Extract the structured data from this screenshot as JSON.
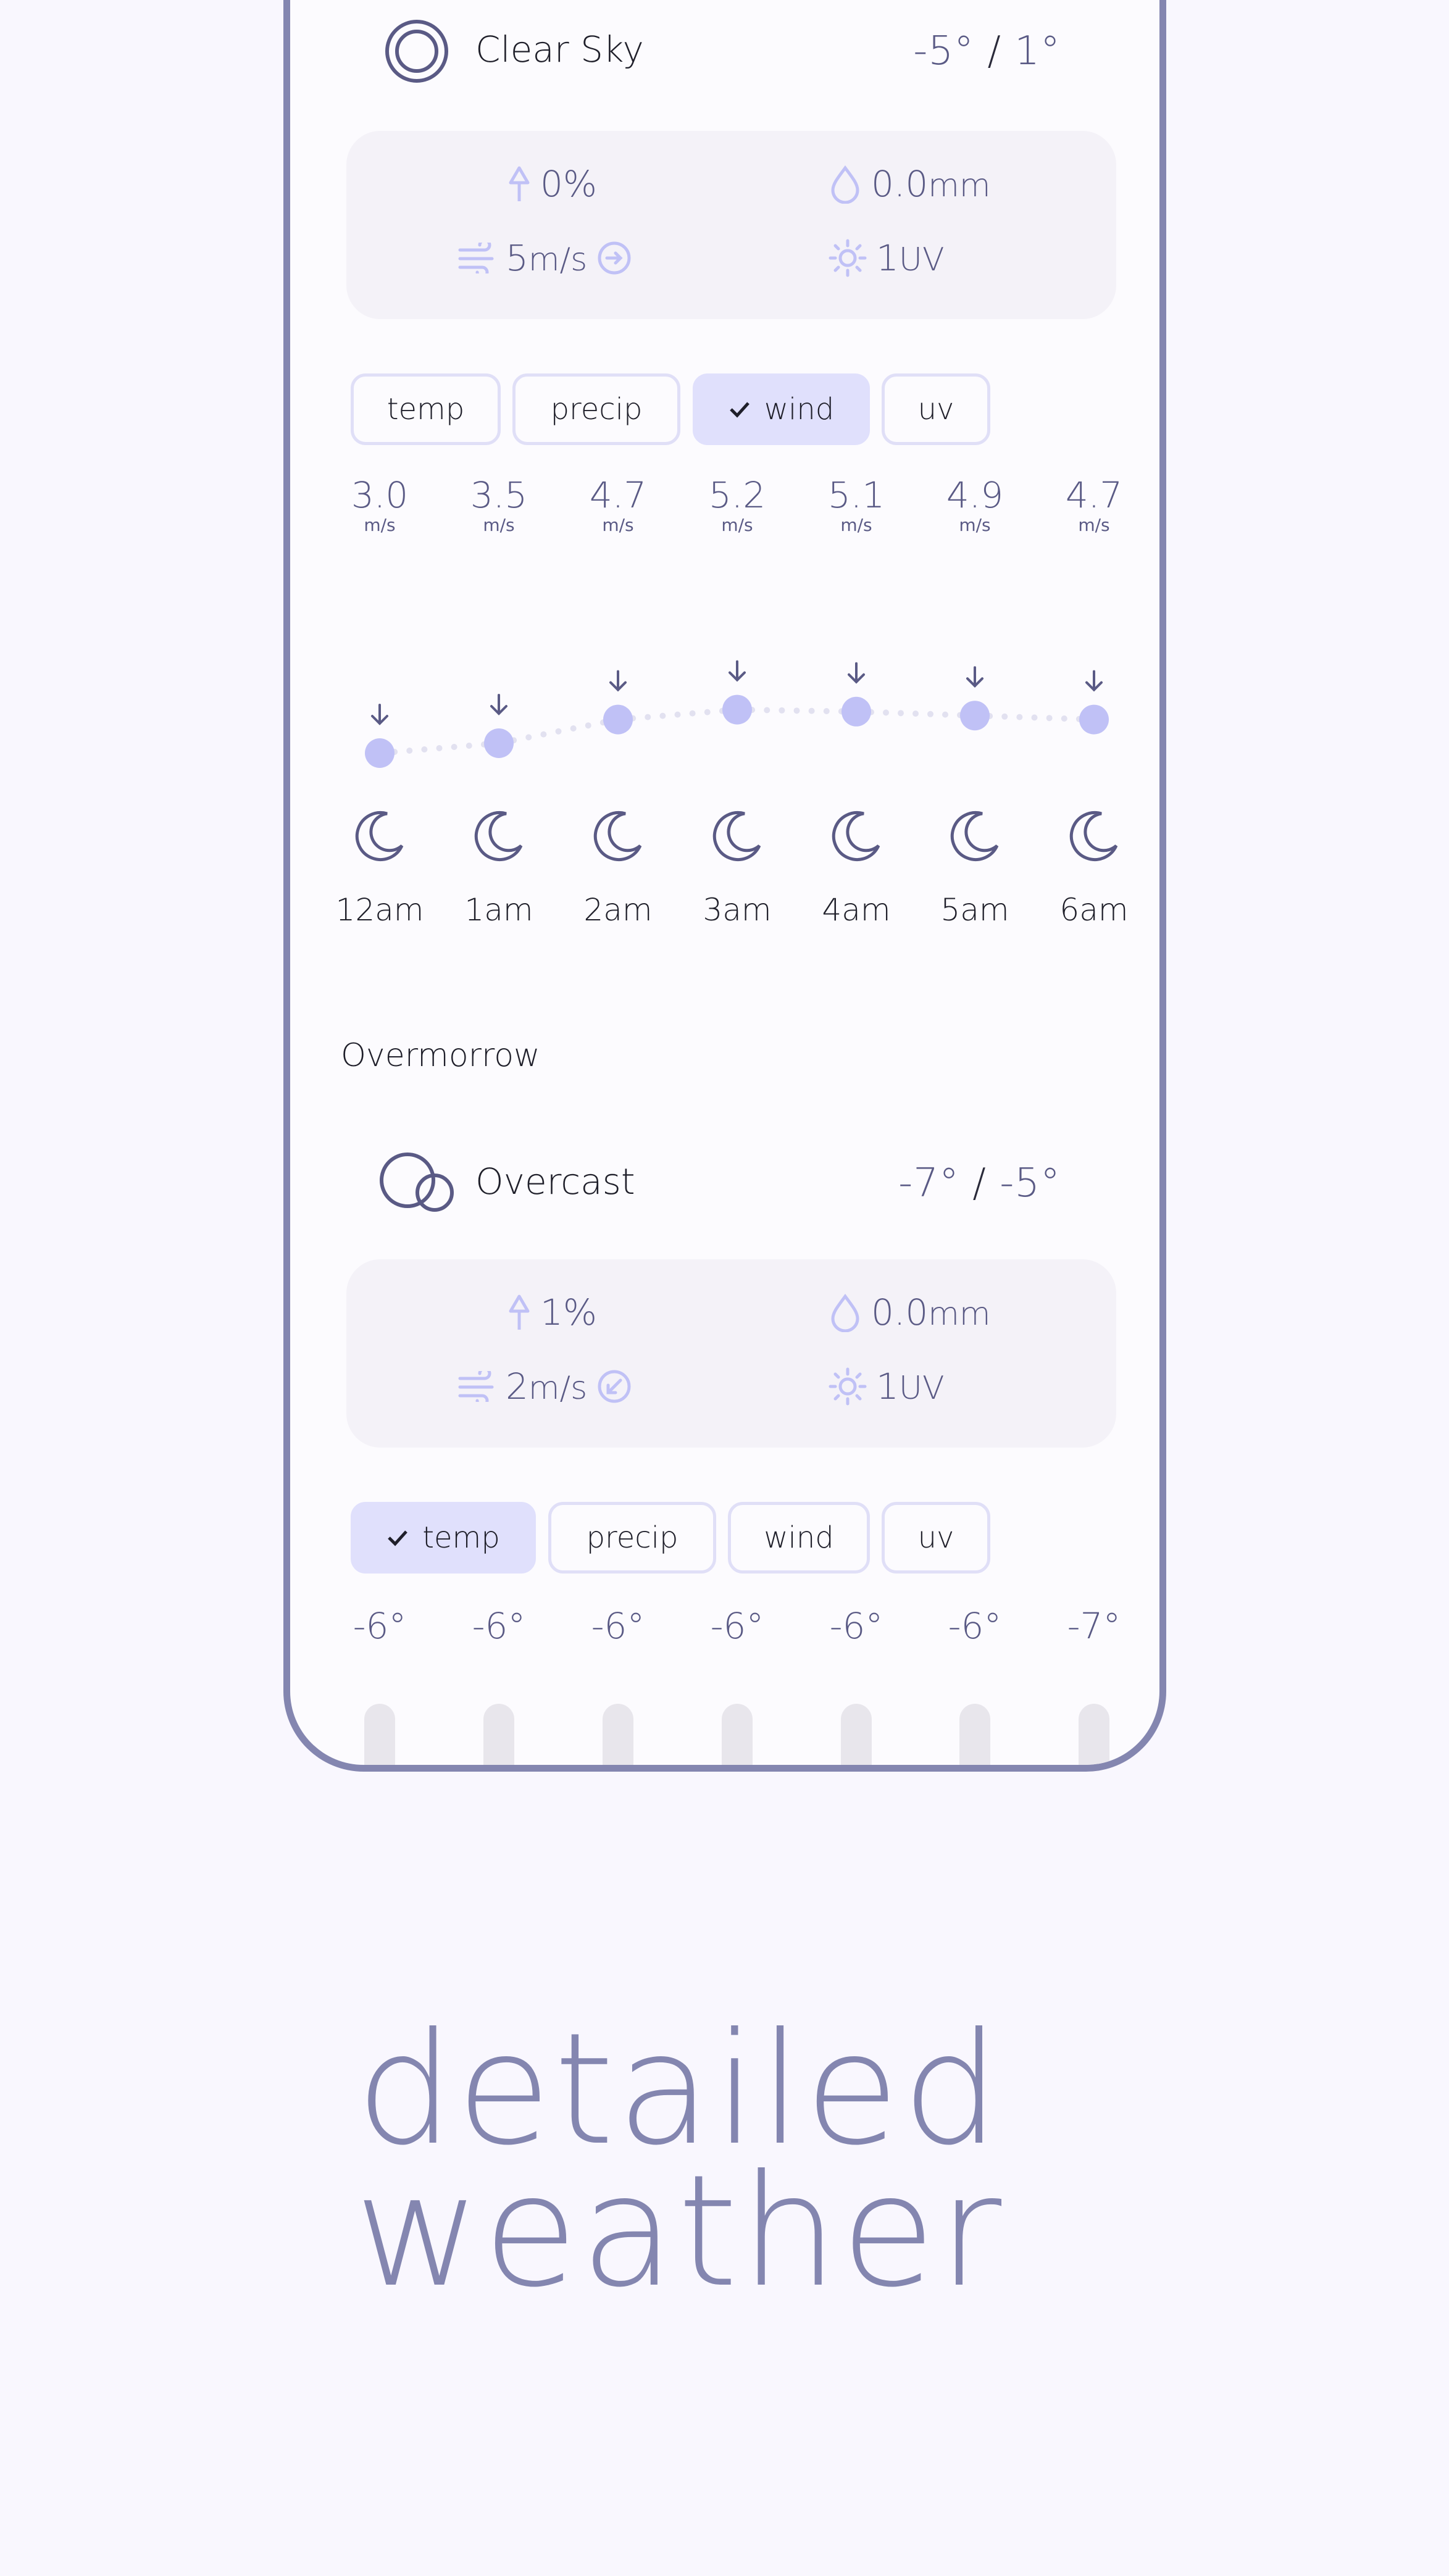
{
  "days": [
    {
      "condition": "Clear Sky",
      "low": "-5°",
      "high": "1°",
      "precip_chance": "0%",
      "precip_amount": "0.0",
      "precip_unit": "mm",
      "wind_speed": "5",
      "wind_unit": "m/s",
      "uv": "1",
      "uv_unit": "UV",
      "selected_tab": "wind"
    },
    {
      "label": "Overmorrow",
      "condition": "Overcast",
      "low": "-7°",
      "high": "-5°",
      "precip_chance": "1%",
      "precip_amount": "0.0",
      "precip_unit": "mm",
      "wind_speed": "2",
      "wind_unit": "m/s",
      "uv": "1",
      "uv_unit": "UV",
      "selected_tab": "temp"
    }
  ],
  "tabs": [
    "temp",
    "precip",
    "wind",
    "uv"
  ],
  "hourly_wind": {
    "unit": "m/s",
    "values": [
      "3.0",
      "3.5",
      "4.7",
      "5.2",
      "5.1",
      "4.9",
      "4.7"
    ],
    "hours": [
      "12am",
      "1am",
      "2am",
      "3am",
      "4am",
      "5am",
      "6am"
    ],
    "icons": [
      "moon-icon",
      "moon-icon",
      "moon-icon",
      "moon-icon",
      "moon-icon",
      "moon-icon",
      "moon-icon"
    ]
  },
  "hourly_temp": {
    "values": [
      "-6°",
      "-6°",
      "-6°",
      "-6°",
      "-6°",
      "-6°",
      "-7°"
    ]
  },
  "tagline": {
    "line1": "detailed",
    "line2": "weather"
  },
  "colors": {
    "frame": "#8486b0",
    "accent": "#c0c1f6",
    "chip_selected": "#e0e0fc",
    "text_muted": "#5a5a85"
  }
}
